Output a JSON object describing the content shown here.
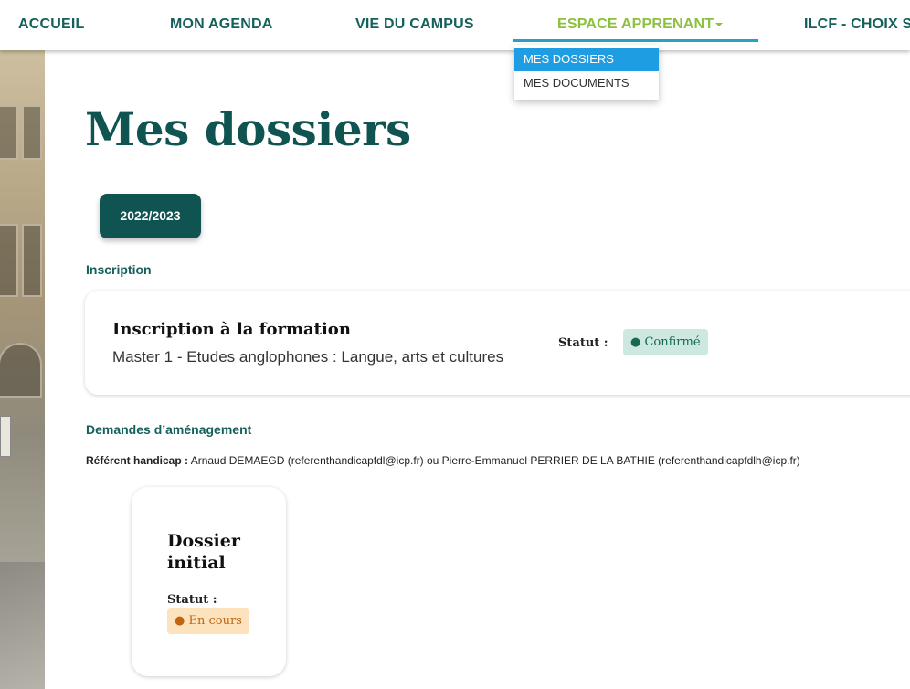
{
  "nav": {
    "items": [
      {
        "label": "ACCUEIL"
      },
      {
        "label": "MON AGENDA"
      },
      {
        "label": "VIE DU CAMPUS"
      },
      {
        "label": "ESPACE APPRENANT"
      },
      {
        "label": "ILCF - CHOIX SE"
      }
    ],
    "dropdown": [
      {
        "label": "MES DOSSIERS"
      },
      {
        "label": "MES DOCUMENTS"
      }
    ]
  },
  "page": {
    "title": "Mes dossiers",
    "year_tab": "2022/2023"
  },
  "inscription": {
    "section_label": "Inscription",
    "card_title": "Inscription à la formation",
    "program": "Master 1 - Etudes anglophones : Langue, arts et cultures",
    "status_label": "Statut :",
    "status_value": "● Confirmé"
  },
  "amenagement": {
    "section_label": "Demandes d’aménagement",
    "referent_label": "Référent handicap :",
    "referent_text": " Arnaud DEMAEGD (referenthandicapfdl@icp.fr) ou Pierre-Emmanuel PERRIER DE LA BATHIE (referenthandicapfdlh@icp.fr)",
    "dossier": {
      "title": "Dossier initial",
      "status_label": "Statut :",
      "status_value": "● En cours"
    }
  },
  "colors": {
    "primary": "#0f5450",
    "nav_active": "#8cc03f",
    "underline": "#2a9fc7",
    "dropdown_selected": "#1e9de3",
    "status_confirmed_bg": "#cce8e0",
    "status_pending_bg": "#fde3bd"
  }
}
